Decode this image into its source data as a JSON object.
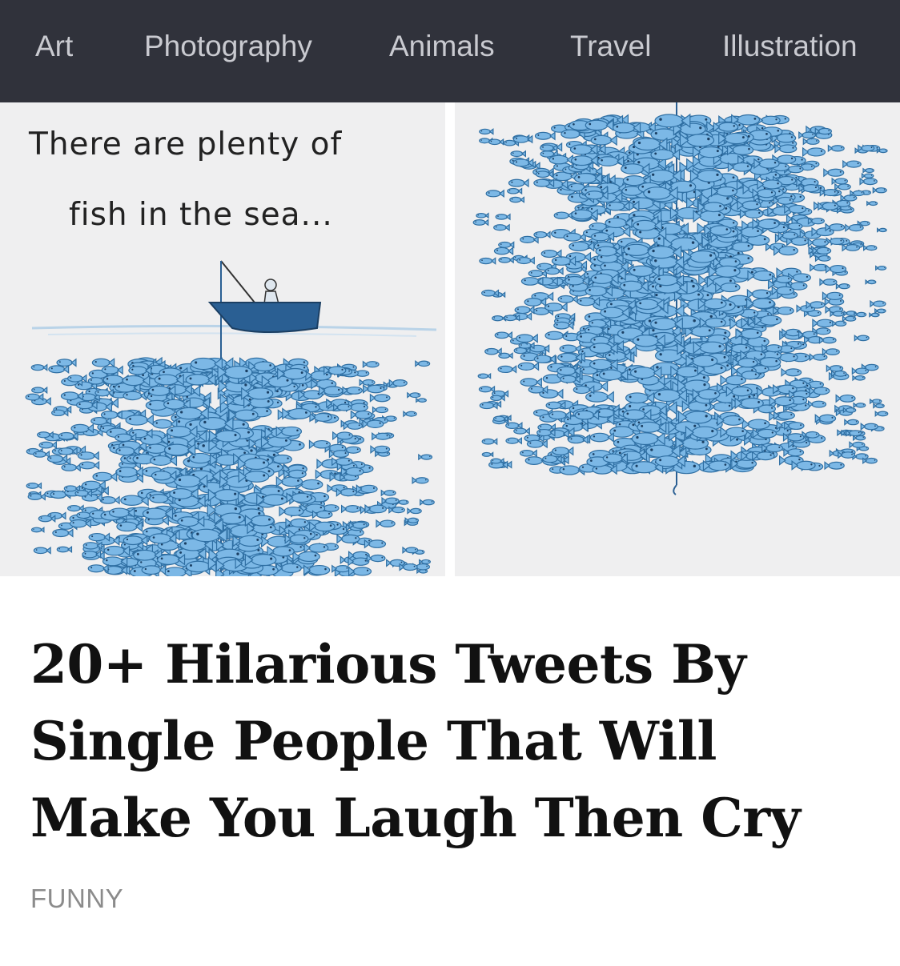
{
  "nav": {
    "items": [
      {
        "label": "Art"
      },
      {
        "label": "Photography"
      },
      {
        "label": "Animals"
      },
      {
        "label": "Travel"
      },
      {
        "label": "Illustration"
      }
    ]
  },
  "hero": {
    "caption_line1": "There are plenty of",
    "caption_line2": "fish in the sea...",
    "fish_color": "#7cb8e6",
    "fish_stroke": "#2f6fa3",
    "boat_color": "#2a5f93"
  },
  "article": {
    "headline_line1": "20+ Hilarious Tweets By",
    "headline_line2": "Single People That Will",
    "headline_line3": "Make You Laugh Then Cry",
    "category": "FUNNY"
  }
}
